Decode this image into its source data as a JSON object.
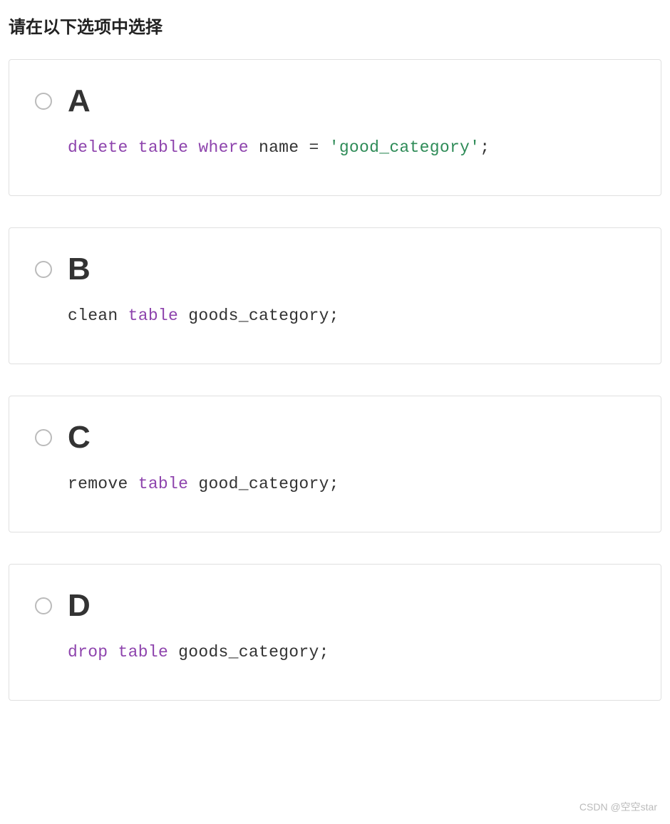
{
  "question": {
    "title": "请在以下选项中选择"
  },
  "options": [
    {
      "letter": "A",
      "tokens": [
        {
          "text": "delete",
          "cls": "kw"
        },
        {
          "text": " ",
          "cls": ""
        },
        {
          "text": "table",
          "cls": "kw"
        },
        {
          "text": " ",
          "cls": ""
        },
        {
          "text": "where",
          "cls": "kw"
        },
        {
          "text": " name ",
          "cls": ""
        },
        {
          "text": "=",
          "cls": "punct"
        },
        {
          "text": " ",
          "cls": ""
        },
        {
          "text": "'good_category'",
          "cls": "str"
        },
        {
          "text": ";",
          "cls": "punct"
        }
      ]
    },
    {
      "letter": "B",
      "tokens": [
        {
          "text": "clean ",
          "cls": ""
        },
        {
          "text": "table",
          "cls": "kw"
        },
        {
          "text": " goods_category;",
          "cls": ""
        }
      ]
    },
    {
      "letter": "C",
      "tokens": [
        {
          "text": "remove ",
          "cls": ""
        },
        {
          "text": "table",
          "cls": "kw"
        },
        {
          "text": " good_category;",
          "cls": ""
        }
      ]
    },
    {
      "letter": "D",
      "tokens": [
        {
          "text": "drop",
          "cls": "kw"
        },
        {
          "text": " ",
          "cls": ""
        },
        {
          "text": "table",
          "cls": "kw"
        },
        {
          "text": " goods_category;",
          "cls": ""
        }
      ]
    }
  ],
  "watermark": "CSDN @空空star"
}
